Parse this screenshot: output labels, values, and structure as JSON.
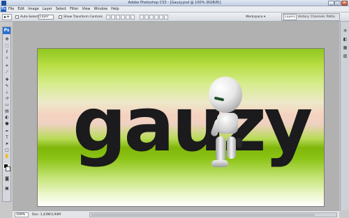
{
  "window": {
    "title": "Adobe Photoshop CS3 - [Gauzy.psd @ 100% (RGB/8)]",
    "min": "_",
    "max": "□",
    "close": "✕"
  },
  "menu": {
    "logo": "Ps",
    "items": [
      "File",
      "Edit",
      "Image",
      "Layer",
      "Select",
      "Filter",
      "View",
      "Window",
      "Help"
    ]
  },
  "options": {
    "tool_glyph": "▸+",
    "auto_select_label": "Auto-Select:",
    "auto_select_value": "Layer",
    "show_transform_label": "Show Transform Controls",
    "workspace_label": "Workspace ▾"
  },
  "panel_tabs": [
    "Layers",
    "History",
    "Channels",
    "Paths"
  ],
  "document": {
    "text": "gauzy"
  },
  "status": {
    "zoom": "100%",
    "doc": "Doc: 1,43M/3,94M"
  }
}
